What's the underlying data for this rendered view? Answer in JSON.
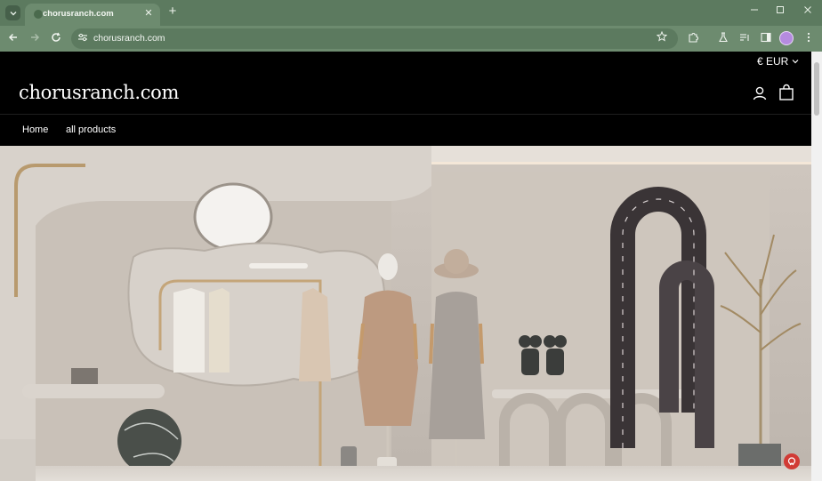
{
  "browser": {
    "tab_title": "chorusranch.com",
    "url": "chorusranch.com",
    "tab_list_icon": "chevron-down-icon",
    "new_tab_symbol": "+",
    "close_symbol": "✕"
  },
  "site": {
    "currency": "€ EUR",
    "logo": "chorusranch.com",
    "nav": [
      "Home",
      "all products"
    ]
  },
  "hero": {
    "image_description_icon": "storefront-window-display"
  }
}
